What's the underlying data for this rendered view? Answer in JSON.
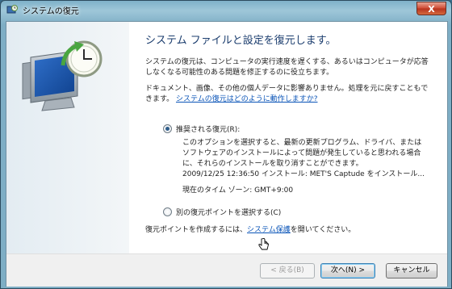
{
  "window": {
    "title": "システムの復元",
    "close_label": "X"
  },
  "content": {
    "heading": "システム ファイルと設定を復元します。",
    "para1": "システムの復元は、コンピュータの実行速度を遅くする、あるいはコンピュータが応答しなくなる可能性のある問題を修正するのに役立ちます。",
    "para2_text": "ドキュメント、画像、その他の個人データに影響ありません。処理を元に戻すこともできます。",
    "para2_link": "システムの復元はどのように動作しますか?",
    "option_recommended": {
      "label": "推奨される復元(R):",
      "description": "このオプションを選択すると、最新の更新プログラム、ドライバ、またはソフトウェアのインストールによって問題が発生していると思われる場合に、それらのインストールを取り消すことができます。",
      "restore_point": "2009/12/25 12:36:50 インストール: MET'S Captude をインストール...",
      "timezone": "現在のタイム ゾーン: GMT+9:00",
      "checked": true
    },
    "option_choose": {
      "label": "別の復元ポイントを選択する(C)",
      "checked": false
    },
    "create_point_prefix": "復元ポイントを作成するには、",
    "create_point_link": "システム保護",
    "create_point_suffix": "を開いてください。"
  },
  "footer": {
    "back_label": "< 戻る(B)",
    "next_label": "次へ(N) >",
    "cancel_label": "キャンセル"
  },
  "icons": {
    "title": "system-restore-icon",
    "side": "restore-monitor-clock-icon"
  }
}
